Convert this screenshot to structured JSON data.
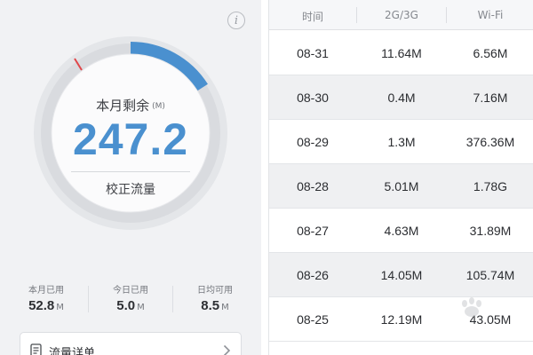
{
  "gauge": {
    "remaining_label": "本月剩余",
    "remaining_unit": "(M)",
    "remaining_value": "247.2",
    "calibrate_label": "校正流量",
    "used_fraction_arc": 0.16,
    "accent_color": "#4a90cf",
    "marker_color": "#e0464a"
  },
  "info_button": {
    "glyph": "i"
  },
  "stats": [
    {
      "label": "本月已用",
      "value": "52.8",
      "unit": "M"
    },
    {
      "label": "今日已用",
      "value": "5.0",
      "unit": "M"
    },
    {
      "label": "日均可用",
      "value": "8.5",
      "unit": "M"
    }
  ],
  "detail_button": {
    "label": "流量详单"
  },
  "table": {
    "headers": [
      "时间",
      "2G/3G",
      "Wi-Fi"
    ],
    "rows": [
      {
        "date": "08-31",
        "mobile": "11.64M",
        "wifi": "6.56M"
      },
      {
        "date": "08-30",
        "mobile": "0.4M",
        "wifi": "7.16M"
      },
      {
        "date": "08-29",
        "mobile": "1.3M",
        "wifi": "376.36M"
      },
      {
        "date": "08-28",
        "mobile": "5.01M",
        "wifi": "1.78G"
      },
      {
        "date": "08-27",
        "mobile": "4.63M",
        "wifi": "31.89M"
      },
      {
        "date": "08-26",
        "mobile": "14.05M",
        "wifi": "105.74M"
      },
      {
        "date": "08-25",
        "mobile": "12.19M",
        "wifi": "43.05M"
      }
    ]
  },
  "watermark": {
    "text": "Baidu"
  }
}
